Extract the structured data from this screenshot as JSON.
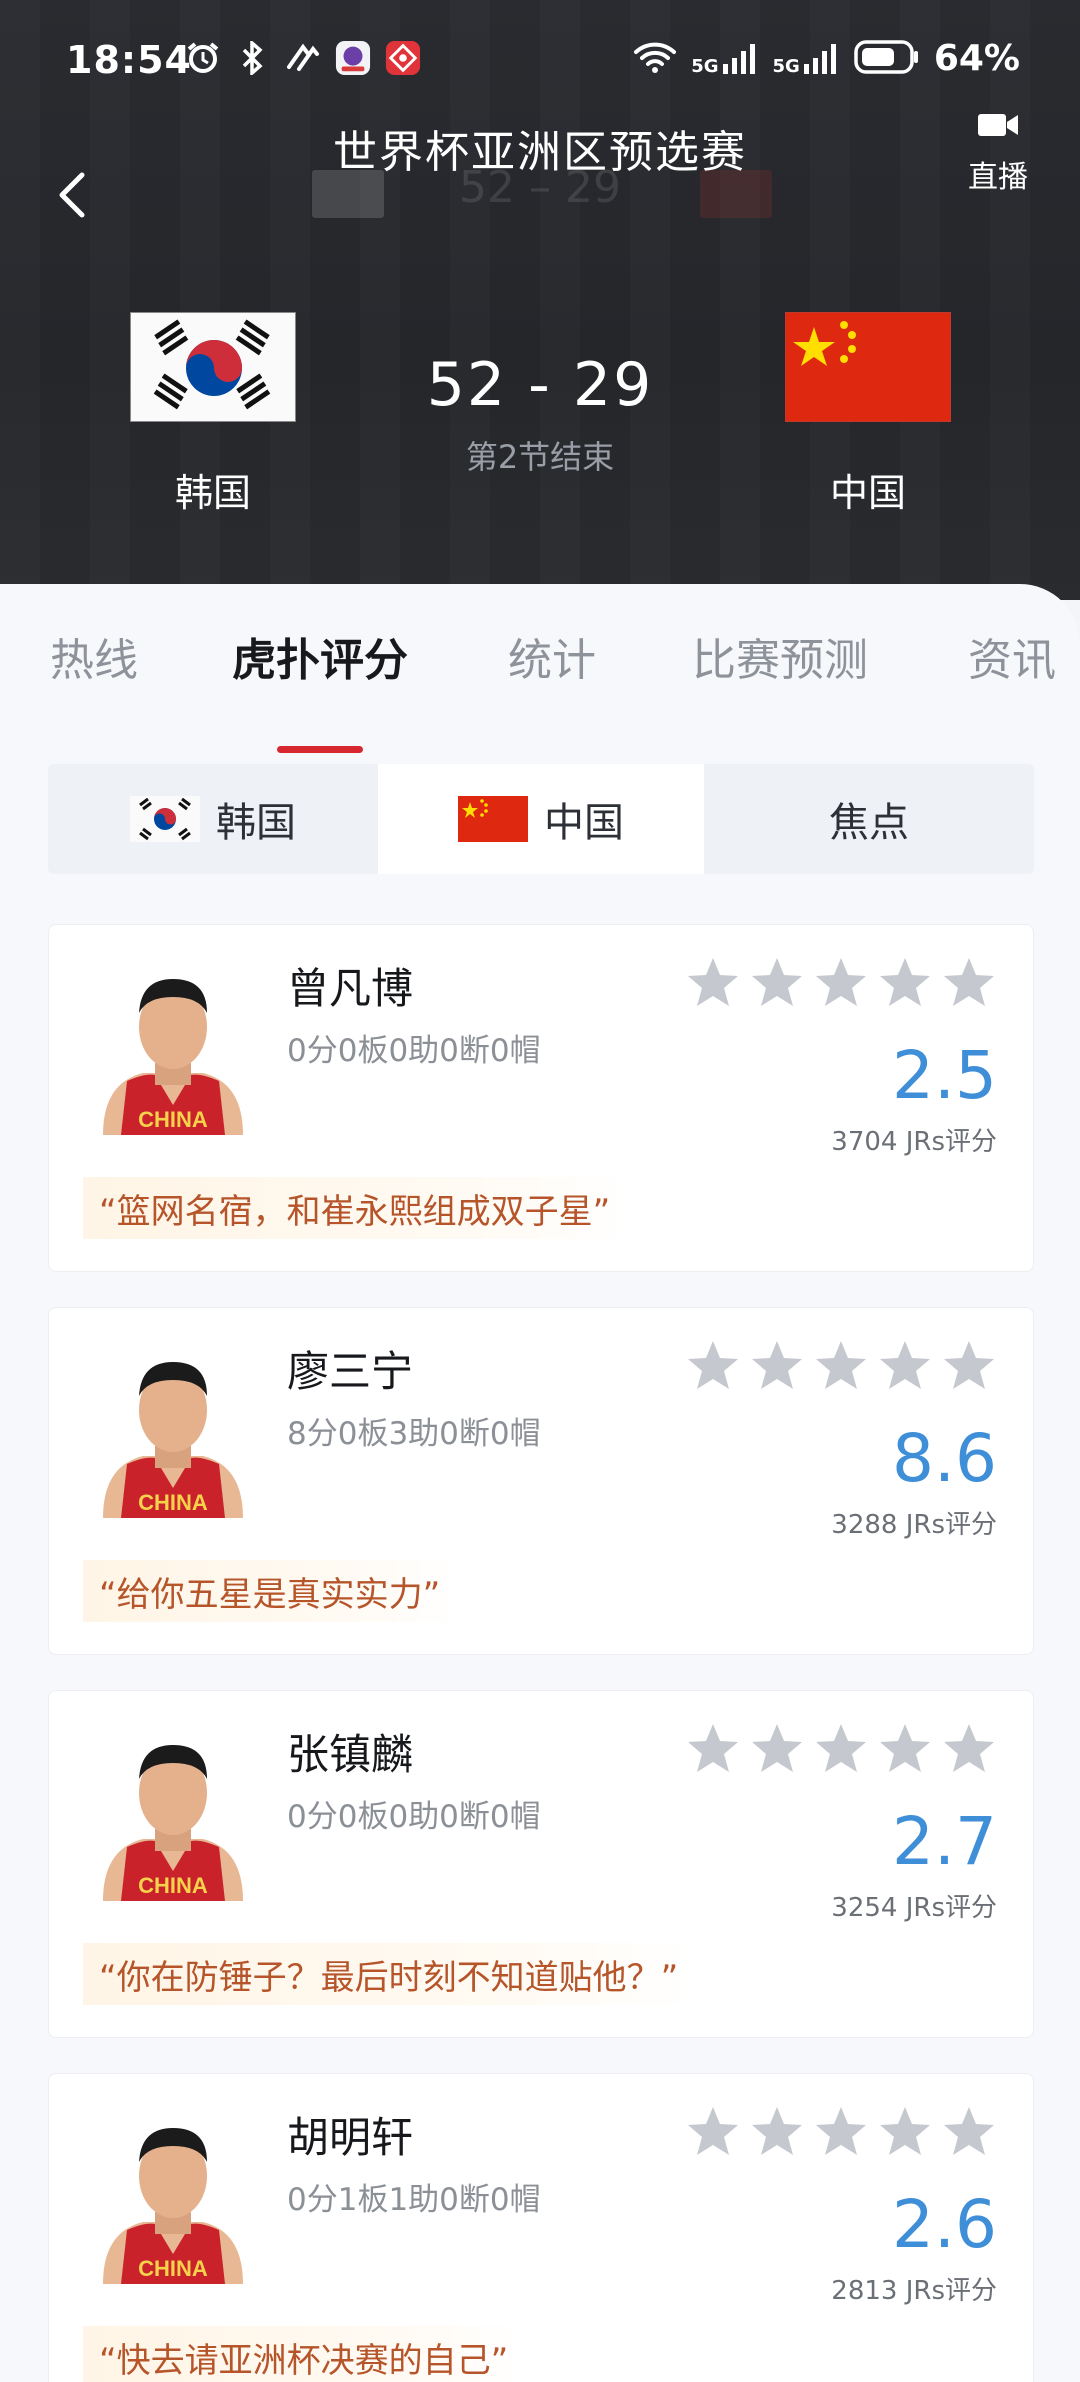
{
  "status_bar": {
    "time": "18:54",
    "signal_1": "5G",
    "signal_2": "5G",
    "battery": "64%",
    "icons": [
      "alarm-icon",
      "bluetooth-icon",
      "nfc-icon",
      "app-badge-purple",
      "app-badge-red",
      "wifi-icon",
      "signal-icon",
      "battery-icon"
    ]
  },
  "header": {
    "title": "世界杯亚洲区预选赛",
    "live_label": "直播",
    "ghost_score": "52 – 29",
    "home_team": "韩国",
    "away_team": "中国",
    "score": "52 - 29",
    "period_status": "第2节结束"
  },
  "tabs": [
    {
      "label": "热线",
      "active": false
    },
    {
      "label": "虎扑评分",
      "active": true
    },
    {
      "label": "统计",
      "active": false
    },
    {
      "label": "比赛预测",
      "active": false
    },
    {
      "label": "资讯",
      "active": false
    }
  ],
  "segments": [
    {
      "label": "韩国",
      "flag": "korea-flag",
      "active": false
    },
    {
      "label": "中国",
      "flag": "china-flag",
      "active": true
    },
    {
      "label": "焦点",
      "active": false
    }
  ],
  "players": [
    {
      "name": "曾凡博",
      "stats": "0分0板0助0断0帽",
      "rating": "2.5",
      "votes": "3704 JRs评分",
      "comment": "“篮网名宿，和崔永熙组成双子星”",
      "jersey": "CHINA"
    },
    {
      "name": "廖三宁",
      "stats": "8分0板3助0断0帽",
      "rating": "8.6",
      "votes": "3288 JRs评分",
      "comment": "“给你五星是真实实力”",
      "jersey": "CHINA"
    },
    {
      "name": "张镇麟",
      "stats": "0分0板0助0断0帽",
      "rating": "2.7",
      "votes": "3254 JRs评分",
      "comment": "“你在防锤子？最后时刻不知道贴他？”",
      "jersey": "CHINA"
    },
    {
      "name": "胡明轩",
      "stats": "0分1板1助0断0帽",
      "rating": "2.6",
      "votes": "2813 JRs评分",
      "comment": "“快去请亚洲杯决赛的自己”",
      "jersey": "CHINA"
    }
  ],
  "colors": {
    "accent_red": "#d7282f",
    "rating_blue": "#3e8ed8",
    "comment_orange": "#b6542a",
    "star_grey": "#c5c8ce"
  }
}
